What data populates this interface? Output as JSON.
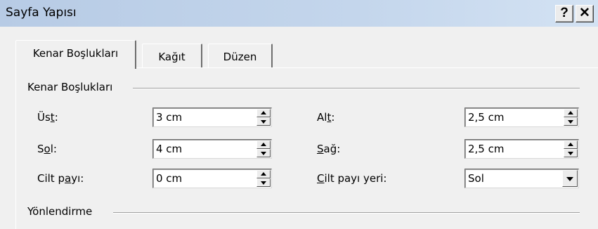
{
  "window": {
    "title": "Sayfa Yapısı",
    "help_label": "?",
    "close_label": "✕"
  },
  "tabs": [
    {
      "label": "Kenar Boşlukları",
      "active": true
    },
    {
      "label": "Kağıt",
      "active": false
    },
    {
      "label": "Düzen",
      "active": false
    }
  ],
  "margins_group": {
    "title": "Kenar Boşlukları",
    "top": {
      "label_a": "Üs",
      "label_u": "t",
      "label_b": ":",
      "value": "3 cm"
    },
    "left": {
      "label_a": "S",
      "label_u": "o",
      "label_b": "l:",
      "value": "4 cm"
    },
    "gutter": {
      "label_a": "Cilt p",
      "label_u": "a",
      "label_b": "yı:",
      "value": "0 cm"
    },
    "bottom": {
      "label_a": "Al",
      "label_u": "t",
      "label_b": ":",
      "value": "2,5 cm"
    },
    "right": {
      "label_a": "",
      "label_u": "S",
      "label_b": "ağ:",
      "value": "2,5 cm"
    },
    "gutter_pos": {
      "label_a": "",
      "label_u": "C",
      "label_b": "ilt payı yeri:",
      "value": "Sol"
    }
  },
  "orientation_group": {
    "title": "Yönlendirme"
  }
}
